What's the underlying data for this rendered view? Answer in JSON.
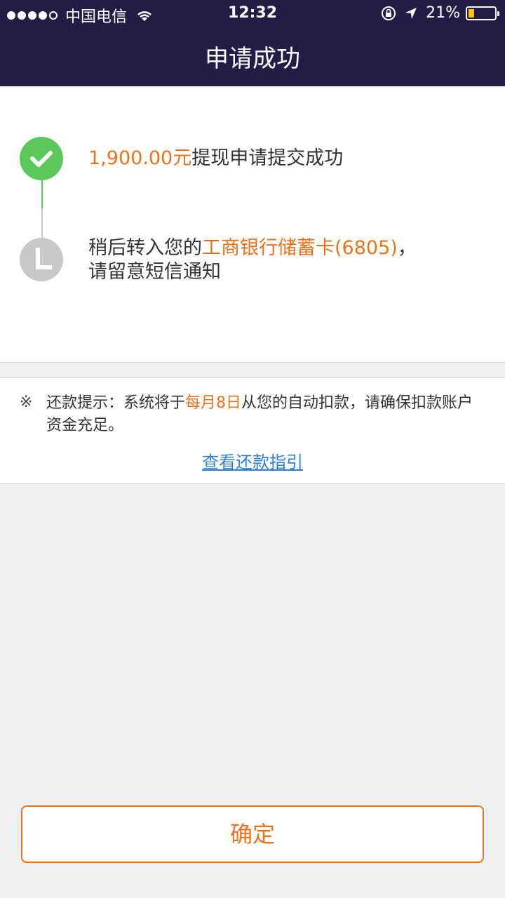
{
  "status_bar": {
    "carrier": "中国电信",
    "time": "12:32",
    "battery": "21%",
    "battery_level": 0.21
  },
  "header": {
    "title": "申请成功"
  },
  "steps": [
    {
      "amount": "1,900.00元",
      "text": "提现申请提交成功",
      "status": "done",
      "icon": "check-icon"
    },
    {
      "prefix": "稍后转入您的",
      "bank": "工商银行储蓄卡(6805)",
      "suffix": "，",
      "line2": "请留意短信通知",
      "status": "pending",
      "icon": "clock-icon"
    }
  ],
  "tip": {
    "mark": "※",
    "prefix": "还款提示：系统将于",
    "highlight": "每月8日",
    "suffix": "从您的自动扣款，请确保扣款账户资金充足。",
    "link": "查看还款指引"
  },
  "confirm_button": "确定",
  "colors": {
    "header_bg": "#241c47",
    "accent": "#e8731c",
    "success": "#5cc85c",
    "pending": "#c8c8c8",
    "link": "#2f7fd8"
  }
}
